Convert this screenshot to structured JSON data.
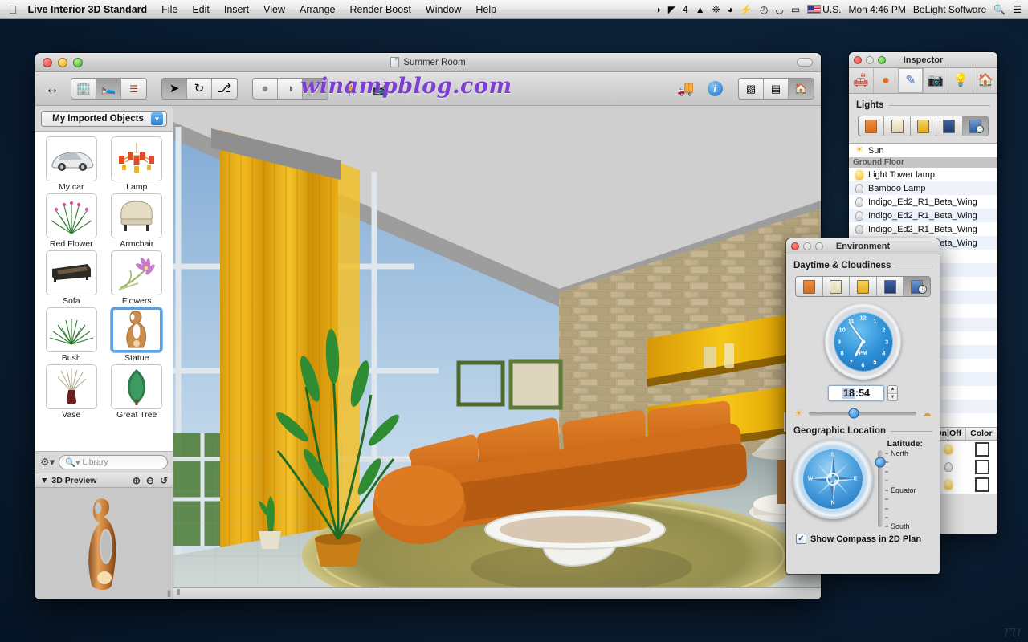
{
  "menubar": {
    "apple_icon": "apple-icon",
    "app_name": "Live Interior 3D Standard",
    "menus": [
      "File",
      "Edit",
      "Insert",
      "View",
      "Arrange",
      "Render Boost",
      "Window",
      "Help"
    ],
    "status_items": [
      {
        "name": "dropbox-icon",
        "glyph": "◑"
      },
      {
        "name": "app-icon",
        "glyph": "◤"
      },
      {
        "name": "notification-count",
        "glyph": "4"
      },
      {
        "name": "drive-icon",
        "glyph": "▲"
      },
      {
        "name": "globe-icon",
        "glyph": "❉"
      },
      {
        "name": "droplet-icon",
        "glyph": "◕"
      },
      {
        "name": "bolt-icon",
        "glyph": "⚡"
      },
      {
        "name": "timemachine-icon",
        "glyph": "◴"
      },
      {
        "name": "wifi-icon",
        "glyph": "◡"
      },
      {
        "name": "battery-icon",
        "glyph": "▭"
      }
    ],
    "input_source": "U.S.",
    "clock": "Mon 4:46 PM",
    "user": "BeLight Software",
    "search_icon": "search-icon",
    "notification_icon": "list-icon"
  },
  "window": {
    "document_title": "Summer Room",
    "watermark": "winampblog.com",
    "toolbar": {
      "arrows_icon": "resize-arrows-icon",
      "view_group": [
        {
          "name": "building-icon",
          "glyph": "🏢",
          "active": false
        },
        {
          "name": "furniture-icon",
          "glyph": "🪑",
          "active": true
        },
        {
          "name": "list-outline-icon",
          "glyph": "☰",
          "active": false
        }
      ],
      "tool_group": [
        {
          "name": "pointer-tool",
          "glyph": "➤",
          "active": true
        },
        {
          "name": "rotate-tool",
          "glyph": "↻",
          "active": false
        },
        {
          "name": "move-tool",
          "glyph": "⚓",
          "active": false
        }
      ],
      "render_group": [
        {
          "name": "shading-flat-icon",
          "glyph": "●",
          "active": false
        },
        {
          "name": "shading-gradient-icon",
          "glyph": "◑",
          "active": false
        },
        {
          "name": "shading-realistic-icon",
          "glyph": "◕",
          "active": true
        }
      ],
      "walk_icon": "walk-through-icon",
      "camera_icon": "camera-icon",
      "forklift_icon": "forklift-icon",
      "info_icon": "info-icon",
      "layout_group": [
        {
          "name": "split-view-icon",
          "glyph": "▧",
          "active": false
        },
        {
          "name": "plan-and-3d-icon",
          "glyph": "▤",
          "active": false
        },
        {
          "name": "3d-only-icon",
          "glyph": "🏠",
          "active": true
        }
      ]
    },
    "library": {
      "collection_label": "My Imported Objects",
      "dropdown_icon": "chevron-down-icon",
      "items": [
        {
          "label": "My car",
          "icon": "car-thumbnail",
          "selected": false
        },
        {
          "label": "Lamp",
          "icon": "chandelier-thumbnail",
          "selected": false
        },
        {
          "label": "Red Flower",
          "icon": "flower-thumbnail",
          "selected": false
        },
        {
          "label": "Armchair",
          "icon": "armchair-thumbnail",
          "selected": false
        },
        {
          "label": "Sofa",
          "icon": "sofa-thumbnail",
          "selected": false
        },
        {
          "label": "Flowers",
          "icon": "flowers-thumbnail",
          "selected": false
        },
        {
          "label": "Bush",
          "icon": "bush-thumbnail",
          "selected": false
        },
        {
          "label": "Statue",
          "icon": "statue-thumbnail",
          "selected": true
        },
        {
          "label": "Vase",
          "icon": "vase-thumbnail",
          "selected": false
        },
        {
          "label": "Great Tree",
          "icon": "tree-thumbnail",
          "selected": false
        }
      ],
      "gear_icon": "gear-icon",
      "search_placeholder": "Library",
      "search_value": "",
      "search_icon": "search-icon",
      "preview_title": "3D Preview",
      "preview_disclosure_icon": "disclosure-triangle-icon",
      "preview_zoom_in_icon": "zoom-in-icon",
      "preview_zoom_out_icon": "zoom-out-icon",
      "preview_reset_icon": "rotate-reset-icon",
      "preview_object": "statue-3d-preview"
    }
  },
  "inspector": {
    "title": "Inspector",
    "tabs": [
      {
        "name": "object-tab",
        "glyph": "🛋",
        "active": false
      },
      {
        "name": "material-tab",
        "glyph": "●",
        "active": false
      },
      {
        "name": "edit-tab",
        "glyph": "✎",
        "active": true
      },
      {
        "name": "camera-tab",
        "glyph": "📷",
        "active": false
      },
      {
        "name": "light-tab",
        "glyph": "💡",
        "active": false
      },
      {
        "name": "site-tab",
        "glyph": "🏠",
        "active": false
      }
    ],
    "section_title": "Lights",
    "daytime_modes": [
      {
        "name": "morning-mode",
        "active": false
      },
      {
        "name": "day-mode",
        "active": false
      },
      {
        "name": "evening-mode",
        "active": false
      },
      {
        "name": "night-mode",
        "active": false
      },
      {
        "name": "automatic-mode",
        "active": true
      }
    ],
    "light_list": [
      {
        "label": "Sun",
        "type": "sun",
        "state": "on"
      },
      {
        "label": "Ground Floor",
        "type": "group"
      },
      {
        "label": "Light Tower lamp",
        "type": "light",
        "state": "on"
      },
      {
        "label": "Bamboo Lamp",
        "type": "light",
        "state": "off"
      },
      {
        "label": "Indigo_Ed2_R1_Beta_Wing",
        "type": "light",
        "state": "off"
      },
      {
        "label": "Indigo_Ed2_R1_Beta_Wing",
        "type": "light",
        "state": "off"
      },
      {
        "label": "Indigo_Ed2_R1_Beta_Wing",
        "type": "light",
        "state": "off"
      },
      {
        "label": "Indigo_Ed2_R1_Beta_Wing",
        "type": "light",
        "state": "off"
      }
    ],
    "columns": [
      "On|Off",
      "Color"
    ],
    "color_rows": [
      {
        "state": "on",
        "color": "#ffffff"
      },
      {
        "state": "off",
        "color": "#ffffff"
      },
      {
        "state": "on",
        "color": "#ffffff"
      }
    ]
  },
  "environment": {
    "title": "Environment",
    "daytime_section": "Daytime & Cloudiness",
    "daytime_modes": [
      {
        "name": "morning-mode",
        "active": false
      },
      {
        "name": "day-mode",
        "active": false
      },
      {
        "name": "evening-mode",
        "active": false
      },
      {
        "name": "night-mode",
        "active": false
      },
      {
        "name": "automatic-mode",
        "active": true
      }
    ],
    "clock": {
      "name": "analog-clock",
      "numerals": [
        "12",
        "1",
        "2",
        "3",
        "4",
        "5",
        "6",
        "7",
        "8",
        "9",
        "10",
        "11"
      ],
      "meridiem": "PM",
      "hour_angle": 207,
      "minute_angle": 324
    },
    "time_value": "18:54",
    "time_hours": "18",
    "time_separator": ":",
    "time_minutes": "54",
    "stepper_up_icon": "stepper-up-icon",
    "stepper_down_icon": "stepper-down-icon",
    "cloudiness_slider": {
      "name": "cloudiness-slider",
      "position_pct": 42,
      "left_icon": "sun-icon",
      "right_icon": "cloud-icon"
    },
    "geo_section": "Geographic Location",
    "compass": {
      "name": "compass-dial",
      "directions": [
        "N",
        "E",
        "S",
        "W"
      ]
    },
    "latitude_label": "Latitude:",
    "latitude_ticks": [
      "North",
      "Equator",
      "South"
    ],
    "latitude_position_pct": 16,
    "show_compass_label": "Show Compass in 2D Plan",
    "show_compass_checked": true,
    "checkmark": "✓"
  },
  "viewport": {
    "name": "3d-render-viewport",
    "scene_colors": {
      "sky": "#9fc4e2",
      "ceiling": "#c9c9c9",
      "curtain": "#e0a414",
      "stone_wall": "#c6b38d",
      "sofa": "#d2691a",
      "floor": "#b9c3c1",
      "rug": "#9a9147",
      "shelf": "#e8a900",
      "plant_green": "#2f7d31"
    }
  }
}
